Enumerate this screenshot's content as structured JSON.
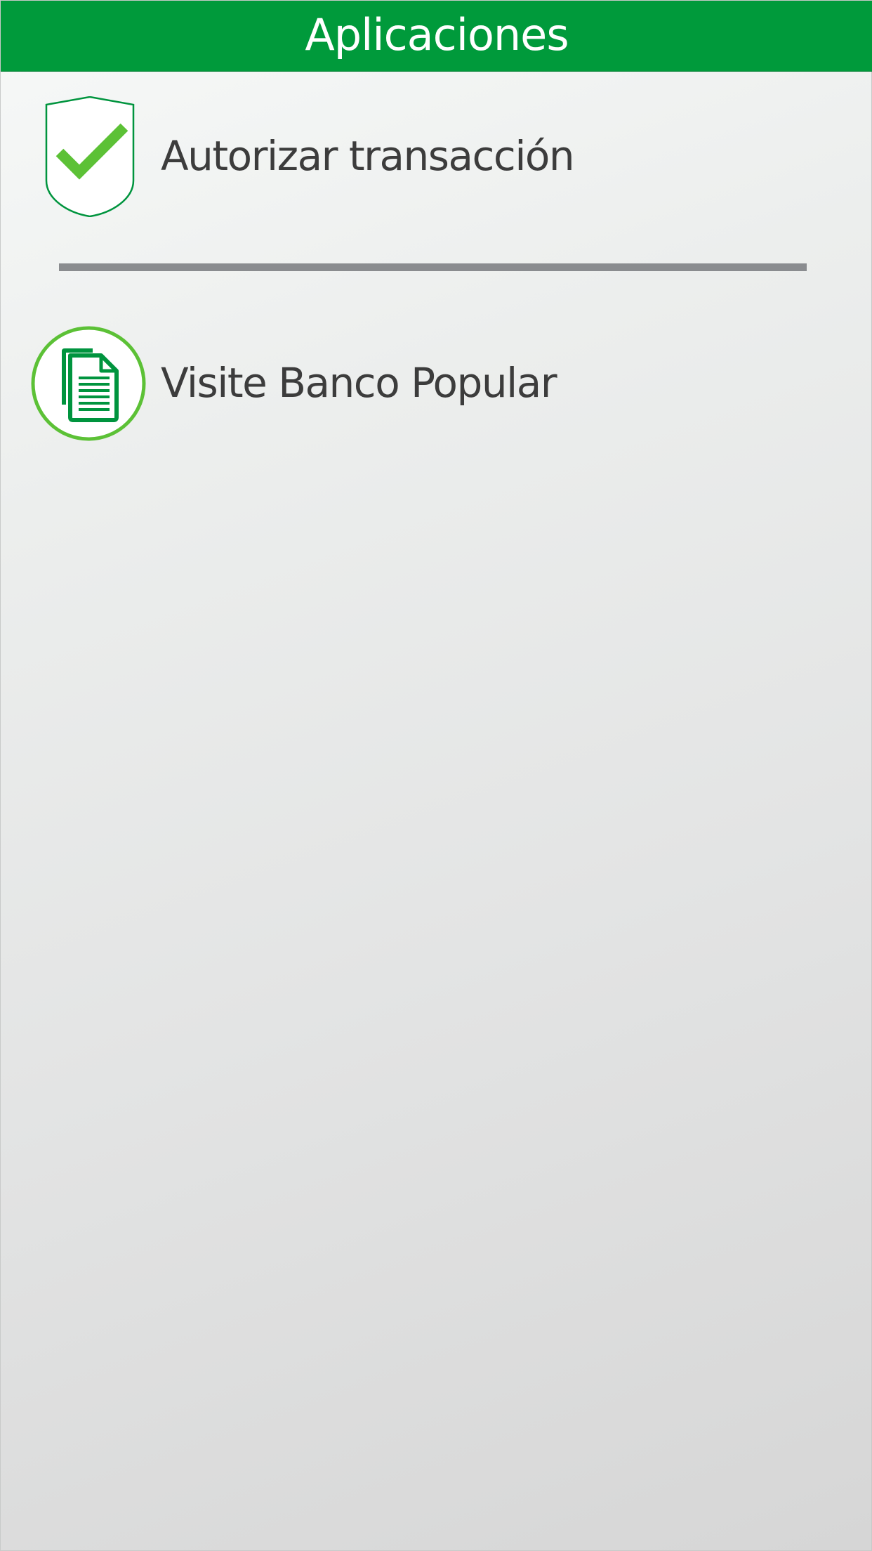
{
  "header": {
    "title": "Aplicaciones"
  },
  "menu": {
    "items": [
      {
        "label": "Autorizar transacción",
        "icon": "shield-check-icon"
      },
      {
        "label": "Visite Banco Popular",
        "icon": "document-icon"
      }
    ]
  },
  "colors": {
    "header_bg": "#009a3b",
    "accent_green": "#5cc136",
    "dark_green": "#00943e",
    "divider": "#8a8c8f",
    "text": "#3c3c3c"
  }
}
